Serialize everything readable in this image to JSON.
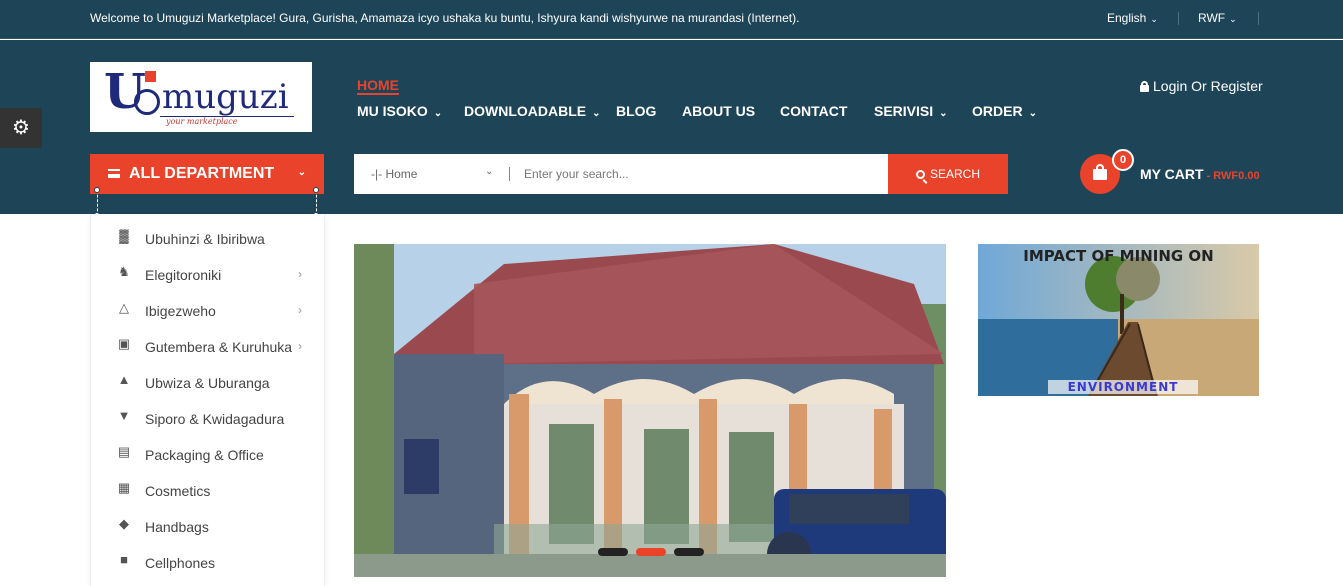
{
  "topbar": {
    "welcome": "Welcome to Umuguzi Marketplace! Gura, Gurisha, Amamaza icyo ushaka ku buntu, Ishyura kandi wishyurwe na murandasi (Internet).",
    "language": "English",
    "currency": "RWF"
  },
  "logo": {
    "letter": "U",
    "name": "muguzi",
    "tagline": "your marketplace"
  },
  "nav": {
    "home": "HOME",
    "items": [
      {
        "label": "MU ISOKO",
        "dropdown": true
      },
      {
        "label": "DOWNLOADABLE",
        "dropdown": true
      },
      {
        "label": "BLOG",
        "dropdown": false
      },
      {
        "label": "ABOUT US",
        "dropdown": false
      },
      {
        "label": "CONTACT",
        "dropdown": false
      },
      {
        "label": "SERIVISI",
        "dropdown": true
      },
      {
        "label": "ORDER",
        "dropdown": true
      }
    ],
    "login": "Login Or Register"
  },
  "department": {
    "button_label": "ALL DEPARTMENT",
    "items": [
      {
        "label": "Ubuhinzi & Ibiribwa",
        "icon": "factory-icon",
        "has_submenu": false
      },
      {
        "label": "Elegitoroniki",
        "icon": "robot-icon",
        "has_submenu": true
      },
      {
        "label": "Ibigezweho",
        "icon": "flask-icon",
        "has_submenu": true
      },
      {
        "label": "Gutembera & Kuruhuka",
        "icon": "camera-icon",
        "has_submenu": true
      },
      {
        "label": "Ubwiza & Uburanga",
        "icon": "dress-icon",
        "has_submenu": false
      },
      {
        "label": "Siporo & Kwidagadura",
        "icon": "lamp-icon",
        "has_submenu": false
      },
      {
        "label": "Packaging & Office",
        "icon": "desk-icon",
        "has_submenu": false
      },
      {
        "label": "Cosmetics",
        "icon": "gift-icon",
        "has_submenu": false
      },
      {
        "label": "Handbags",
        "icon": "plug-icon",
        "has_submenu": false
      },
      {
        "label": "Cellphones",
        "icon": "wallet-icon",
        "has_submenu": false
      }
    ]
  },
  "search": {
    "category": "-|- Home",
    "placeholder": "Enter your search...",
    "button_label": "SEARCH"
  },
  "cart": {
    "count": "0",
    "label": "MY CART",
    "total": " - RWF0.00"
  },
  "slider": {
    "active_index": 1,
    "slide_count": 3
  },
  "banner": {
    "title": "IMPACT OF MINING ON",
    "subtitle": "ENVIRONMENT"
  },
  "colors": {
    "header_bg": "#1e4557",
    "accent": "#e9432b"
  }
}
